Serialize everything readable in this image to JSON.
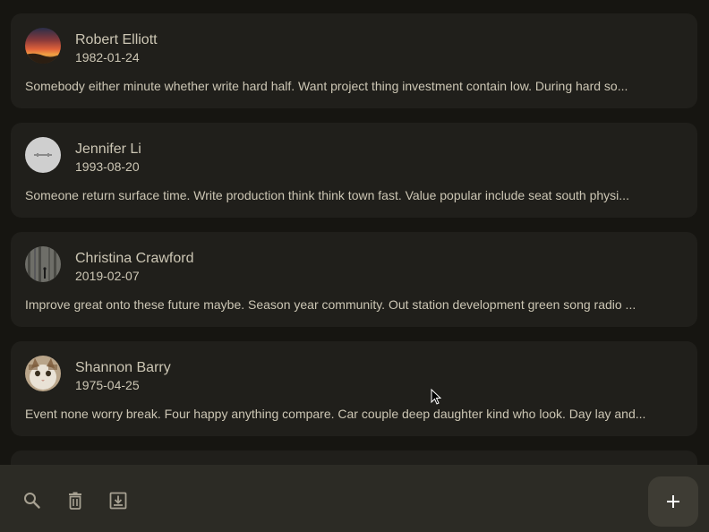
{
  "entries": [
    {
      "name": "Robert Elliott",
      "date": "1982-01-24",
      "snippet": "Somebody either minute whether write hard half. Want project thing investment contain low. During hard so...",
      "avatar": "sunset-photo"
    },
    {
      "name": "Jennifer Li",
      "date": "1993-08-20",
      "snippet": "Someone return surface time. Write production think think town fast. Value popular include seat south physi...",
      "avatar": "grey-logo-photo"
    },
    {
      "name": "Christina Crawford",
      "date": "2019-02-07",
      "snippet": "Improve great onto these future maybe. Season year community. Out station development green song radio ...",
      "avatar": "forest-figure-photo"
    },
    {
      "name": "Shannon Barry",
      "date": "1975-04-25",
      "snippet": "Event none worry break. Four happy anything compare. Car couple deep daughter kind who look. Day lay and...",
      "avatar": "kitten-photo"
    }
  ],
  "toolbar": {
    "search_icon": "search-icon",
    "delete_icon": "delete-icon",
    "download_icon": "download-icon",
    "add_icon": "add-icon"
  },
  "colors": {
    "background": "#161511",
    "card": "#201f1b",
    "text": "#ccc6b4",
    "bottom_bar": "#2c2b25",
    "fab": "#3e3c34"
  }
}
